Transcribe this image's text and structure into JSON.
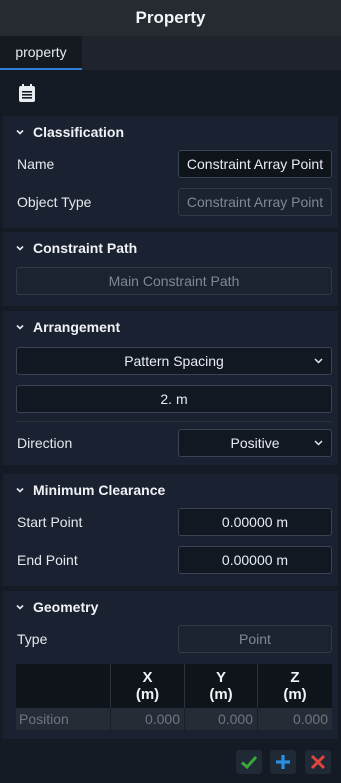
{
  "window": {
    "title": "Property"
  },
  "tabs": [
    {
      "label": "property",
      "active": true
    }
  ],
  "toolbar": {
    "icon": "document-icon"
  },
  "sections": {
    "classification": {
      "title": "Classification",
      "name_label": "Name",
      "name_value": "Constraint Array Point",
      "object_type_label": "Object Type",
      "object_type_value": "Constraint Array Point"
    },
    "constraint_path": {
      "title": "Constraint Path",
      "button_label": "Main Constraint Path"
    },
    "arrangement": {
      "title": "Arrangement",
      "mode_value": "Pattern Spacing",
      "spacing_value": "2. m",
      "direction_label": "Direction",
      "direction_value": "Positive"
    },
    "minimum_clearance": {
      "title": "Minimum Clearance",
      "start_label": "Start Point",
      "start_value": "0.00000 m",
      "end_label": "End Point",
      "end_value": "0.00000 m"
    },
    "geometry": {
      "title": "Geometry",
      "type_label": "Type",
      "type_value": "Point",
      "grid": {
        "headers": [
          {
            "axis": "X",
            "unit": "(m)"
          },
          {
            "axis": "Y",
            "unit": "(m)"
          },
          {
            "axis": "Z",
            "unit": "(m)"
          }
        ],
        "rows": [
          {
            "label": "Position",
            "values": [
              "0.000",
              "0.000",
              "0.000"
            ]
          }
        ]
      }
    }
  },
  "footer": {
    "ok": "check-icon",
    "add": "plus-icon",
    "cancel": "close-icon"
  },
  "colors": {
    "accent": "#2f7fd6",
    "ok_green": "#3aa63a",
    "add_blue": "#2b8fe0",
    "cancel_red": "#e0453a"
  }
}
